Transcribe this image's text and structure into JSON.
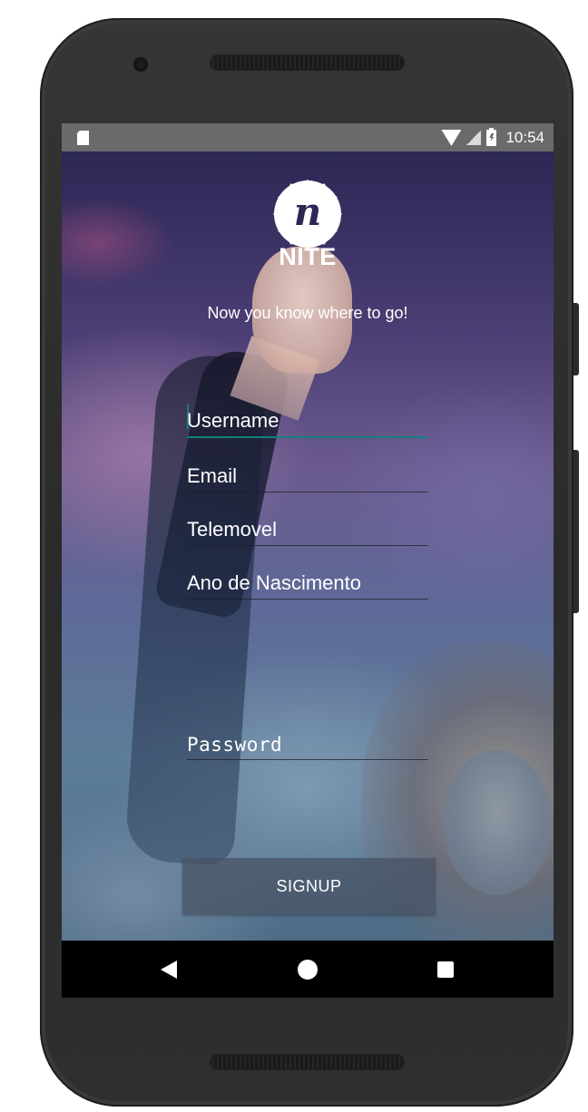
{
  "status_bar": {
    "time": "10:54",
    "icons": [
      "sd-card-icon",
      "wifi-icon",
      "signal-icon",
      "battery-charging-icon"
    ]
  },
  "app": {
    "logo_letter": "n",
    "title": "NITE",
    "tagline": "Now you know where to go!"
  },
  "form": {
    "username_placeholder": "Username",
    "email_placeholder": "Email",
    "phone_placeholder": "Telemovel",
    "birth_year_placeholder": "Ano de Nascimento",
    "password_placeholder": "Password",
    "signup_label": "SIGNUP"
  },
  "colors": {
    "accent": "#11807b",
    "status_bar": "#6a6a6a",
    "logo_text": "#2b2855"
  },
  "nav_bar": {
    "icons": [
      "back-icon",
      "home-icon",
      "recents-icon"
    ]
  }
}
